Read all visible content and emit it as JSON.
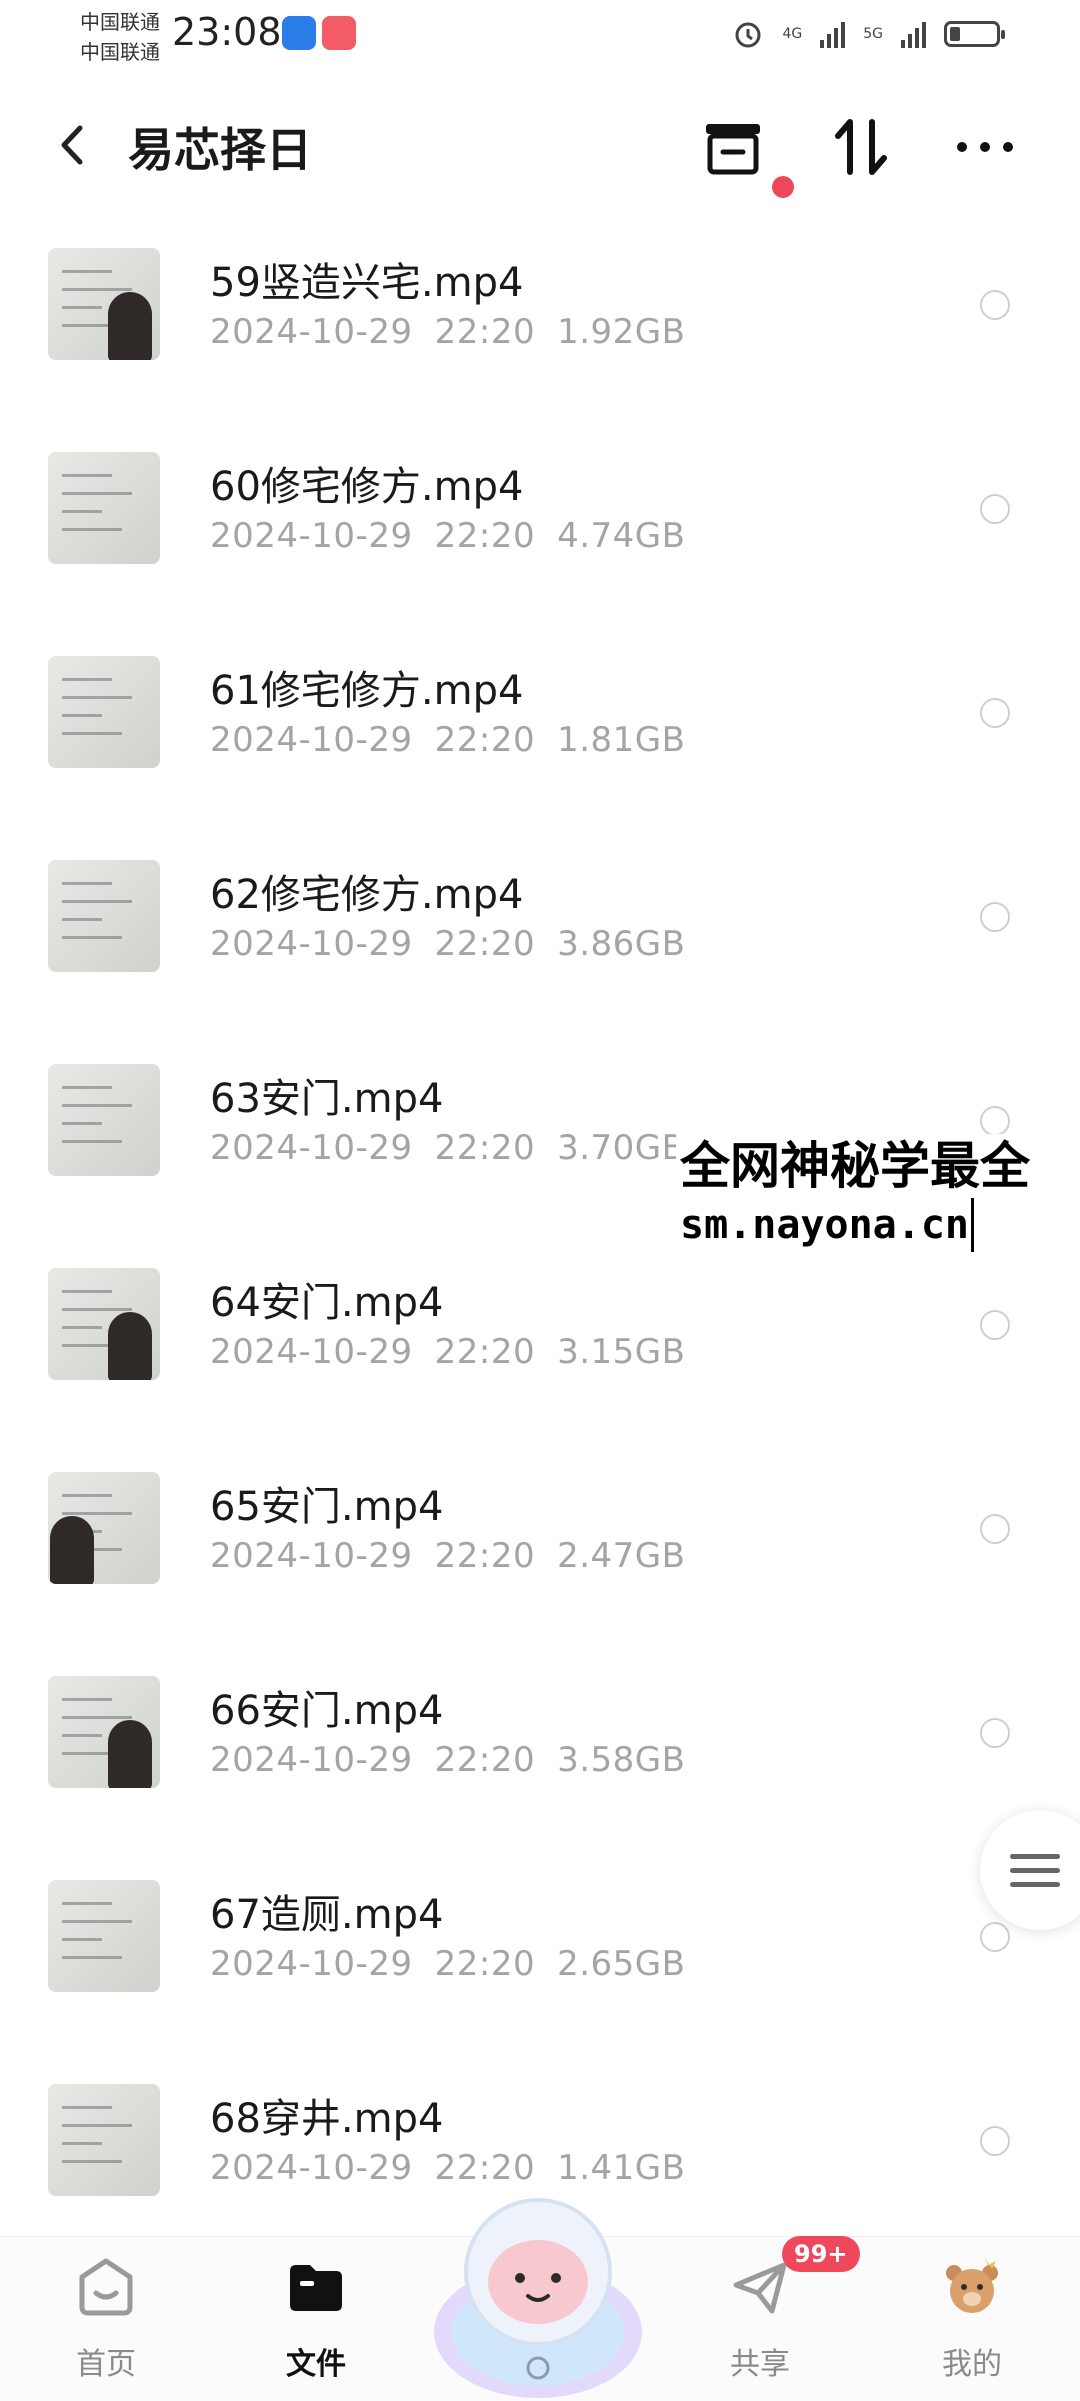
{
  "status_bar": {
    "carrier1": "中国联通",
    "carrier2": "中国联通",
    "time": "23:08",
    "net1": "4G",
    "net2": "5G"
  },
  "header": {
    "title": "易芯择日"
  },
  "files": [
    {
      "name": "59竖造兴宅.mp4",
      "date": "2024-10-29",
      "time": "22:20",
      "size": "1.92GB"
    },
    {
      "name": "60修宅修方.mp4",
      "date": "2024-10-29",
      "time": "22:20",
      "size": "4.74GB"
    },
    {
      "name": "61修宅修方.mp4",
      "date": "2024-10-29",
      "time": "22:20",
      "size": "1.81GB"
    },
    {
      "name": "62修宅修方.mp4",
      "date": "2024-10-29",
      "time": "22:20",
      "size": "3.86GB"
    },
    {
      "name": "63安门.mp4",
      "date": "2024-10-29",
      "time": "22:20",
      "size": "3.70GB"
    },
    {
      "name": "64安门.mp4",
      "date": "2024-10-29",
      "time": "22:20",
      "size": "3.15GB"
    },
    {
      "name": "65安门.mp4",
      "date": "2024-10-29",
      "time": "22:20",
      "size": "2.47GB"
    },
    {
      "name": "66安门.mp4",
      "date": "2024-10-29",
      "time": "22:20",
      "size": "3.58GB"
    },
    {
      "name": "67造厕.mp4",
      "date": "2024-10-29",
      "time": "22:20",
      "size": "2.65GB"
    },
    {
      "name": "68穿井.mp4",
      "date": "2024-10-29",
      "time": "22:20",
      "size": "1.41GB"
    }
  ],
  "watermark": {
    "line1": "全网神秘学最全",
    "line2": "sm.nayona.cn"
  },
  "bottom_nav": {
    "home": "首页",
    "files": "文件",
    "share": "共享",
    "mine": "我的",
    "share_badge": "99+"
  },
  "colors": {
    "accent_red": "#f0485b",
    "meta_gray": "#a4a4a4"
  }
}
